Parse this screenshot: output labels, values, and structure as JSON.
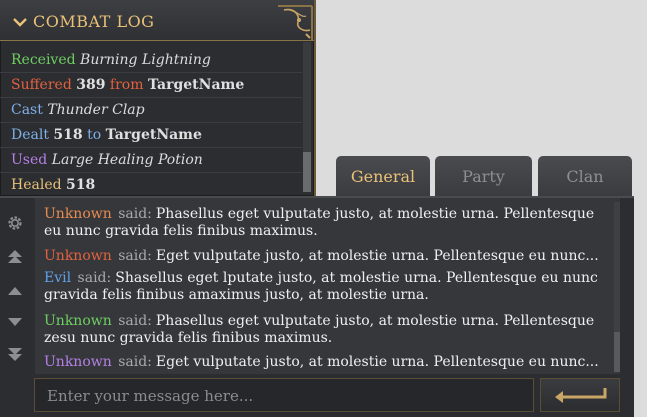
{
  "combat_log": {
    "title": "COMBAT LOG",
    "entries": [
      {
        "p1": "Received",
        "p1_color": "#6fcf62",
        "p2": "Burning Lightning"
      },
      {
        "p1": "Suffered",
        "p1_color": "#e3623f",
        "p2": "389",
        "p3": "from",
        "p4": "TargetName"
      },
      {
        "p1": "Cast",
        "p1_color": "#7fb0e6",
        "p2": "Thunder Clap"
      },
      {
        "p1": "Dealt",
        "p1_color": "#7fb0e6",
        "p2": "518",
        "p3": "to",
        "p4": "TargetName"
      },
      {
        "p1": "Used",
        "p1_color": "#b680e6",
        "p2": "Large Healing Potion"
      },
      {
        "p1": "Healed",
        "p1_color": "#e9c178",
        "p2": "518"
      }
    ]
  },
  "tabs": [
    {
      "label": "General",
      "active": true
    },
    {
      "label": "Party",
      "active": false
    },
    {
      "label": "Clan",
      "active": false
    }
  ],
  "messages": [
    {
      "name": "Unknown",
      "color": "#e88b4f",
      "said": "said:",
      "text": "Phasellus eget vulputate justo, at molestie urna. Pellentesque eu nunc gravida felis finibus maximus."
    },
    {
      "name": "Unknown",
      "color": "#e3623f",
      "said": "said:",
      "text": "Eget vulputate justo, at molestie urna. Pellentesque eu nunc..."
    },
    {
      "name": "Evil",
      "color": "#5fa0e6",
      "said": "said:",
      "text": "Shasellus eget lputate justo, at molestie urna. Pellentesque eu nunc gravida felis finibus amaximus  justo, at molestie urna."
    },
    {
      "name": "Unknown",
      "color": "#6fcf62",
      "said": "said:",
      "text": "Phasellus eget vulputate justo, at molestie urna. Pellentesque zesu nunc gravida felis finibus maximus."
    },
    {
      "name": "Unknown",
      "color": "#b680e6",
      "said": "said:",
      "text": "Eget vulputate justo, at molestie urna. Pellentesque eu nunc..."
    }
  ],
  "input": {
    "placeholder": "Enter your message here..."
  },
  "colors": {
    "gold": "#e9c178",
    "panel": "#2b2d31",
    "muted": "#a8a9ad"
  }
}
